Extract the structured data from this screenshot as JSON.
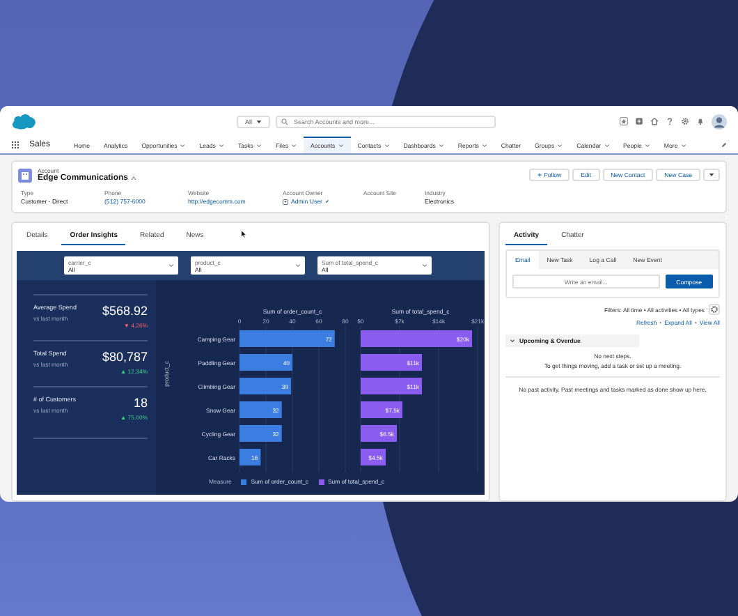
{
  "global_header": {
    "search_scope": "All",
    "search_placeholder": "Search Accounts and more..."
  },
  "nav": {
    "app_name": "Sales",
    "items": [
      {
        "label": "Home",
        "menu": false,
        "selected": false
      },
      {
        "label": "Analytics",
        "menu": false,
        "selected": false
      },
      {
        "label": "Opportunities",
        "menu": true,
        "selected": false
      },
      {
        "label": "Leads",
        "menu": true,
        "selected": false
      },
      {
        "label": "Tasks",
        "menu": true,
        "selected": false
      },
      {
        "label": "Files",
        "menu": true,
        "selected": false
      },
      {
        "label": "Accounts",
        "menu": true,
        "selected": true
      },
      {
        "label": "Contacts",
        "menu": true,
        "selected": false
      },
      {
        "label": "Dashboards",
        "menu": true,
        "selected": false
      },
      {
        "label": "Reports",
        "menu": true,
        "selected": false
      },
      {
        "label": "Chatter",
        "menu": false,
        "selected": false
      },
      {
        "label": "Groups",
        "menu": true,
        "selected": false
      },
      {
        "label": "Calendar",
        "menu": true,
        "selected": false
      },
      {
        "label": "People",
        "menu": true,
        "selected": false
      },
      {
        "label": "More",
        "menu": true,
        "selected": false
      }
    ]
  },
  "record": {
    "object": "Account",
    "name": "Edge Communications",
    "buttons": [
      "Follow",
      "Edit",
      "New Contact",
      "New Case"
    ],
    "fields": [
      {
        "label": "Type",
        "value": "Customer - Direct",
        "kind": "text"
      },
      {
        "label": "Phone",
        "value": "(512) 757-6000",
        "kind": "link"
      },
      {
        "label": "Website",
        "value": "http://edgecomm.com",
        "kind": "link"
      },
      {
        "label": "Account Owner",
        "value": "Admin User",
        "kind": "user"
      },
      {
        "label": "Account Site",
        "kind": "empty"
      },
      {
        "label": "Industry",
        "value": "Electronics",
        "kind": "text"
      }
    ]
  },
  "tabs": [
    {
      "label": "Details",
      "selected": false
    },
    {
      "label": "Order Insights",
      "selected": true
    },
    {
      "label": "Related",
      "selected": false
    },
    {
      "label": "News",
      "selected": false
    }
  ],
  "dashboard": {
    "filters": [
      {
        "label": "carrier_c",
        "value": "All"
      },
      {
        "label": "product_c",
        "value": "All"
      },
      {
        "label": "Sum of total_spend_c",
        "value": "All"
      }
    ],
    "kpis": [
      {
        "label": "Average Spend",
        "value": "$568.92",
        "sub": "vs last month",
        "change": "▼ 4.26%",
        "kind": "down"
      },
      {
        "label": "Total Spend",
        "value": "$80,787",
        "sub": "vs last month",
        "change": "▲ 12.34%",
        "kind": "up"
      },
      {
        "label": "# of Customers",
        "value": "18",
        "sub": "vs last month",
        "change": "▲ 75.00%",
        "kind": "up"
      }
    ],
    "y_axis_label": "product_c",
    "charts": [
      {
        "chart_data": {
          "type": "bar",
          "orientation": "horizontal",
          "title": "Sum of order_count_c",
          "categories": [
            "Camping Gear",
            "Paddling Gear",
            "Climbing Gear",
            "Snow Gear",
            "Cycling Gear",
            "Car Racks"
          ],
          "series": [
            {
              "name": "Sum of order_count_c",
              "color": "#3b7de0",
              "values": [
                72,
                40,
                39,
                32,
                32,
                16
              ]
            }
          ],
          "xlim": [
            0,
            80
          ],
          "xticks": [
            0,
            20,
            40,
            60,
            80
          ],
          "grid": true,
          "data_labels": true
        }
      },
      {
        "chart_data": {
          "type": "bar",
          "orientation": "horizontal",
          "title": "Sum of total_spend_c",
          "series": [
            {
              "name": "Sum of total_spend_c",
              "color": "#8a5cf0",
              "values": [
                20000,
                11000,
                11000,
                7500,
                6500,
                4500
              ]
            }
          ],
          "xlim": [
            0,
            21000
          ],
          "grid": true,
          "xticks": [
            {
              "value": 0,
              "label": "$0"
            },
            {
              "value": 7000,
              "label": "$7k"
            },
            {
              "value": 14000,
              "label": "$14k"
            },
            {
              "value": 21000,
              "label": "$21k"
            }
          ],
          "value_labels": [
            "$20k",
            "$11k",
            "$11k",
            "$7.5k",
            "$6.5k",
            "$4.5k"
          ]
        }
      }
    ],
    "legend_title": "Measure"
  },
  "activity": {
    "tabs": [
      {
        "label": "Activity",
        "selected": true
      },
      {
        "label": "Chatter",
        "selected": false
      }
    ],
    "composer_tabs": [
      {
        "label": "Email",
        "selected": true
      },
      {
        "label": "New Task",
        "selected": false
      },
      {
        "label": "Log a Call",
        "selected": false
      },
      {
        "label": "New Event",
        "selected": false
      }
    ],
    "email_placeholder": "Write an email...",
    "compose_button": "Compose",
    "filters": "Filters: All time • All activities • All types",
    "links": [
      "Refresh",
      "Expand All",
      "View All"
    ],
    "link_separator": "•",
    "section": "Upcoming & Overdue",
    "empty_title": "No next steps.",
    "empty_text": "To get things moving, add a task or set up a meeting.",
    "past_text": "No past activity. Past meetings and tasks marked as done show up here."
  }
}
